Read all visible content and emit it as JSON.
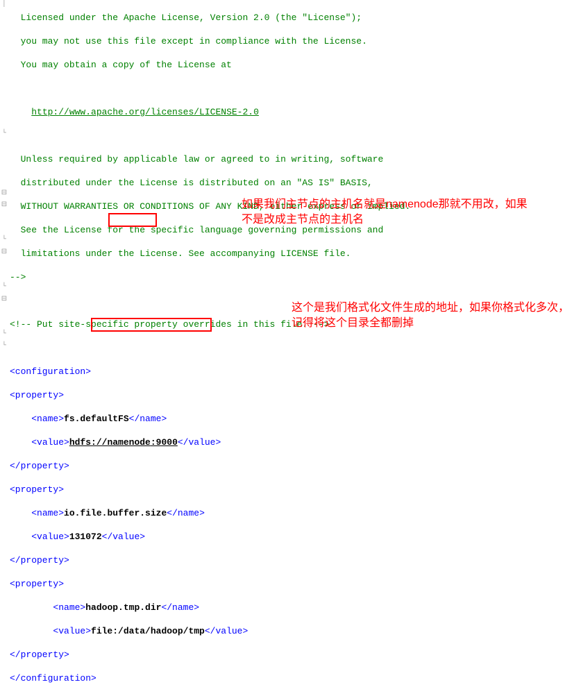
{
  "lines": {
    "c1": "  Licensed under the Apache License, Version 2.0 (the \"License\");",
    "c2": "  you may not use this file except in compliance with the License.",
    "c3": "  You may obtain a copy of the License at",
    "c4": "",
    "c5_pre": "    ",
    "c5_url": "http://www.apache.org/licenses/LICENSE-2.0",
    "c6": "",
    "c7": "  Unless required by applicable law or agreed to in writing, software",
    "c8": "  distributed under the License is distributed on an \"AS IS\" BASIS,",
    "c9": "  WITHOUT WARRANTIES OR CONDITIONS OF ANY KIND, either express or implied.",
    "c10": "  See the License for the specific language governing permissions and",
    "c11": "  limitations under the License. See accompanying LICENSE file.",
    "c12": "-->",
    "c13": "",
    "c14": "<!-- Put site-specific property overrides in this file. -->",
    "c15": "",
    "tag_configuration_open": "<configuration>",
    "tag_property_open": "<property>",
    "tag_property_close": "</property>",
    "tag_configuration_close": "</configuration>",
    "indent4": "    ",
    "indent8": "        ",
    "tag_name_open": "<name>",
    "tag_name_close": "</name>",
    "tag_value_open": "<value>",
    "tag_value_close": "</value>",
    "name1": "fs.defaultFS",
    "value1_a": "hdfs://",
    "value1_b": "namenode",
    "value1_c": ":9000",
    "name2": "io.file.buffer.size",
    "value2": "131072",
    "name3": "hadoop.tmp.dir",
    "value3": "file:/data/hadoop/tmp"
  },
  "annotations": {
    "a1": "如果我们主节点的主机名就是namenode那就不用改，如果不是改成主节点的主机名",
    "a2": "这个是我们格式化文件生成的地址，如果你格式化多次，记得将这个目录全都删掉"
  },
  "gutter": {
    "minus": "⊟",
    "bar": "│",
    "end": "└"
  }
}
